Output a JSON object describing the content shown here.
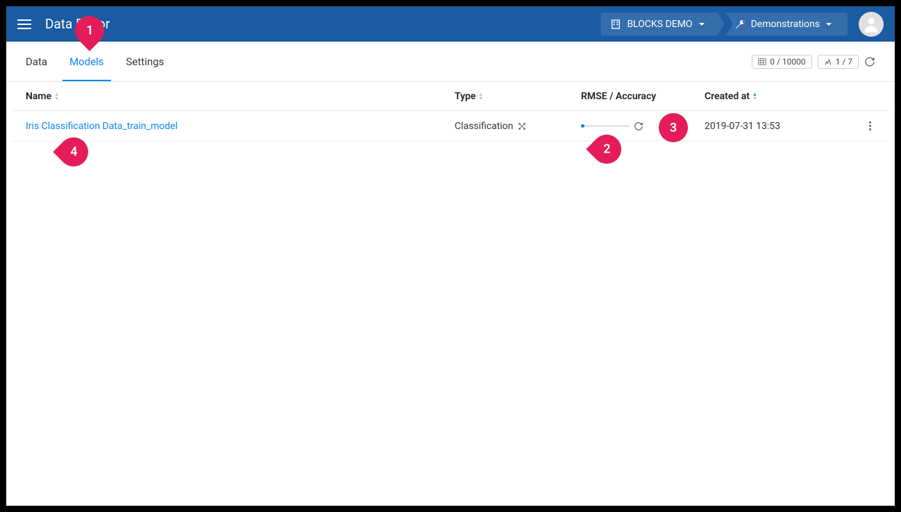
{
  "header": {
    "title": "Data Editor",
    "breadcrumbs": [
      {
        "label": "BLOCKS DEMO"
      },
      {
        "label": "Demonstrations"
      }
    ]
  },
  "tabs": {
    "data": "Data",
    "models": "Models",
    "settings": "Settings",
    "active": "models"
  },
  "status": {
    "rows": "0 / 10000",
    "cols": "1 / 7"
  },
  "columns": {
    "name": "Name",
    "type": "Type",
    "rmse": "RMSE / Accuracy",
    "created": "Created at"
  },
  "rows": [
    {
      "name": "Iris Classification Data_train_model",
      "type": "Classification",
      "created": "2019-07-31 13:53"
    }
  ],
  "callouts": {
    "c1": "1",
    "c2": "2",
    "c3": "3",
    "c4": "4"
  }
}
